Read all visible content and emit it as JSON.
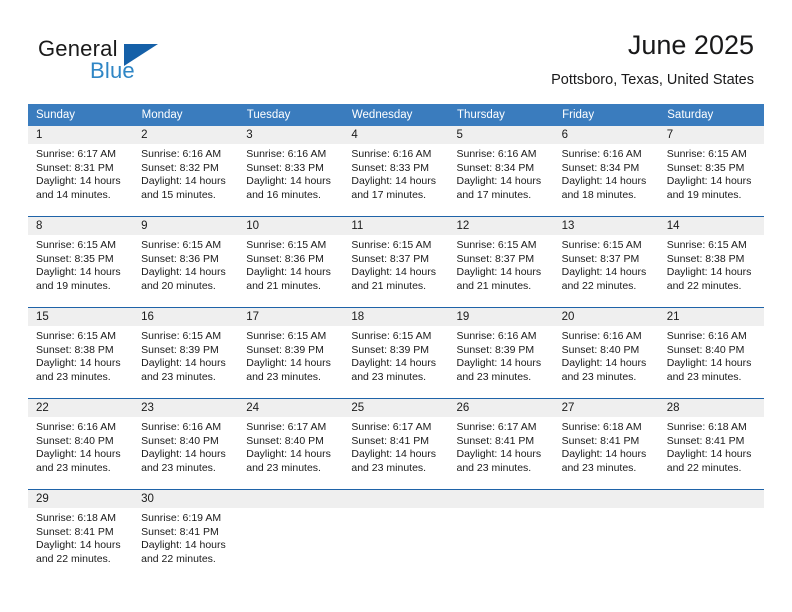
{
  "brand": {
    "line1": "General",
    "line2": "Blue",
    "flag_icon": "triangle-flag-icon",
    "accent_color": "#1560a8",
    "blue_text_color": "#2f86c5"
  },
  "header": {
    "month_title": "June 2025",
    "location": "Pottsboro, Texas, United States"
  },
  "theme": {
    "header_row_bg": "#3a7cbe",
    "daynum_band_bg": "#efefef",
    "row_separator": "#1f63a8",
    "text_color": "#1a1a1a"
  },
  "weekday_headers": [
    "Sunday",
    "Monday",
    "Tuesday",
    "Wednesday",
    "Thursday",
    "Friday",
    "Saturday"
  ],
  "weeks": [
    [
      {
        "day": "1",
        "sunrise": "Sunrise: 6:17 AM",
        "sunset": "Sunset: 8:31 PM",
        "daylight_line1": "Daylight: 14 hours",
        "daylight_line2": "and 14 minutes."
      },
      {
        "day": "2",
        "sunrise": "Sunrise: 6:16 AM",
        "sunset": "Sunset: 8:32 PM",
        "daylight_line1": "Daylight: 14 hours",
        "daylight_line2": "and 15 minutes."
      },
      {
        "day": "3",
        "sunrise": "Sunrise: 6:16 AM",
        "sunset": "Sunset: 8:33 PM",
        "daylight_line1": "Daylight: 14 hours",
        "daylight_line2": "and 16 minutes."
      },
      {
        "day": "4",
        "sunrise": "Sunrise: 6:16 AM",
        "sunset": "Sunset: 8:33 PM",
        "daylight_line1": "Daylight: 14 hours",
        "daylight_line2": "and 17 minutes."
      },
      {
        "day": "5",
        "sunrise": "Sunrise: 6:16 AM",
        "sunset": "Sunset: 8:34 PM",
        "daylight_line1": "Daylight: 14 hours",
        "daylight_line2": "and 17 minutes."
      },
      {
        "day": "6",
        "sunrise": "Sunrise: 6:16 AM",
        "sunset": "Sunset: 8:34 PM",
        "daylight_line1": "Daylight: 14 hours",
        "daylight_line2": "and 18 minutes."
      },
      {
        "day": "7",
        "sunrise": "Sunrise: 6:15 AM",
        "sunset": "Sunset: 8:35 PM",
        "daylight_line1": "Daylight: 14 hours",
        "daylight_line2": "and 19 minutes."
      }
    ],
    [
      {
        "day": "8",
        "sunrise": "Sunrise: 6:15 AM",
        "sunset": "Sunset: 8:35 PM",
        "daylight_line1": "Daylight: 14 hours",
        "daylight_line2": "and 19 minutes."
      },
      {
        "day": "9",
        "sunrise": "Sunrise: 6:15 AM",
        "sunset": "Sunset: 8:36 PM",
        "daylight_line1": "Daylight: 14 hours",
        "daylight_line2": "and 20 minutes."
      },
      {
        "day": "10",
        "sunrise": "Sunrise: 6:15 AM",
        "sunset": "Sunset: 8:36 PM",
        "daylight_line1": "Daylight: 14 hours",
        "daylight_line2": "and 21 minutes."
      },
      {
        "day": "11",
        "sunrise": "Sunrise: 6:15 AM",
        "sunset": "Sunset: 8:37 PM",
        "daylight_line1": "Daylight: 14 hours",
        "daylight_line2": "and 21 minutes."
      },
      {
        "day": "12",
        "sunrise": "Sunrise: 6:15 AM",
        "sunset": "Sunset: 8:37 PM",
        "daylight_line1": "Daylight: 14 hours",
        "daylight_line2": "and 21 minutes."
      },
      {
        "day": "13",
        "sunrise": "Sunrise: 6:15 AM",
        "sunset": "Sunset: 8:37 PM",
        "daylight_line1": "Daylight: 14 hours",
        "daylight_line2": "and 22 minutes."
      },
      {
        "day": "14",
        "sunrise": "Sunrise: 6:15 AM",
        "sunset": "Sunset: 8:38 PM",
        "daylight_line1": "Daylight: 14 hours",
        "daylight_line2": "and 22 minutes."
      }
    ],
    [
      {
        "day": "15",
        "sunrise": "Sunrise: 6:15 AM",
        "sunset": "Sunset: 8:38 PM",
        "daylight_line1": "Daylight: 14 hours",
        "daylight_line2": "and 23 minutes."
      },
      {
        "day": "16",
        "sunrise": "Sunrise: 6:15 AM",
        "sunset": "Sunset: 8:39 PM",
        "daylight_line1": "Daylight: 14 hours",
        "daylight_line2": "and 23 minutes."
      },
      {
        "day": "17",
        "sunrise": "Sunrise: 6:15 AM",
        "sunset": "Sunset: 8:39 PM",
        "daylight_line1": "Daylight: 14 hours",
        "daylight_line2": "and 23 minutes."
      },
      {
        "day": "18",
        "sunrise": "Sunrise: 6:15 AM",
        "sunset": "Sunset: 8:39 PM",
        "daylight_line1": "Daylight: 14 hours",
        "daylight_line2": "and 23 minutes."
      },
      {
        "day": "19",
        "sunrise": "Sunrise: 6:16 AM",
        "sunset": "Sunset: 8:39 PM",
        "daylight_line1": "Daylight: 14 hours",
        "daylight_line2": "and 23 minutes."
      },
      {
        "day": "20",
        "sunrise": "Sunrise: 6:16 AM",
        "sunset": "Sunset: 8:40 PM",
        "daylight_line1": "Daylight: 14 hours",
        "daylight_line2": "and 23 minutes."
      },
      {
        "day": "21",
        "sunrise": "Sunrise: 6:16 AM",
        "sunset": "Sunset: 8:40 PM",
        "daylight_line1": "Daylight: 14 hours",
        "daylight_line2": "and 23 minutes."
      }
    ],
    [
      {
        "day": "22",
        "sunrise": "Sunrise: 6:16 AM",
        "sunset": "Sunset: 8:40 PM",
        "daylight_line1": "Daylight: 14 hours",
        "daylight_line2": "and 23 minutes."
      },
      {
        "day": "23",
        "sunrise": "Sunrise: 6:16 AM",
        "sunset": "Sunset: 8:40 PM",
        "daylight_line1": "Daylight: 14 hours",
        "daylight_line2": "and 23 minutes."
      },
      {
        "day": "24",
        "sunrise": "Sunrise: 6:17 AM",
        "sunset": "Sunset: 8:40 PM",
        "daylight_line1": "Daylight: 14 hours",
        "daylight_line2": "and 23 minutes."
      },
      {
        "day": "25",
        "sunrise": "Sunrise: 6:17 AM",
        "sunset": "Sunset: 8:41 PM",
        "daylight_line1": "Daylight: 14 hours",
        "daylight_line2": "and 23 minutes."
      },
      {
        "day": "26",
        "sunrise": "Sunrise: 6:17 AM",
        "sunset": "Sunset: 8:41 PM",
        "daylight_line1": "Daylight: 14 hours",
        "daylight_line2": "and 23 minutes."
      },
      {
        "day": "27",
        "sunrise": "Sunrise: 6:18 AM",
        "sunset": "Sunset: 8:41 PM",
        "daylight_line1": "Daylight: 14 hours",
        "daylight_line2": "and 23 minutes."
      },
      {
        "day": "28",
        "sunrise": "Sunrise: 6:18 AM",
        "sunset": "Sunset: 8:41 PM",
        "daylight_line1": "Daylight: 14 hours",
        "daylight_line2": "and 22 minutes."
      }
    ],
    [
      {
        "day": "29",
        "sunrise": "Sunrise: 6:18 AM",
        "sunset": "Sunset: 8:41 PM",
        "daylight_line1": "Daylight: 14 hours",
        "daylight_line2": "and 22 minutes."
      },
      {
        "day": "30",
        "sunrise": "Sunrise: 6:19 AM",
        "sunset": "Sunset: 8:41 PM",
        "daylight_line1": "Daylight: 14 hours",
        "daylight_line2": "and 22 minutes."
      },
      {
        "day": "",
        "sunrise": "",
        "sunset": "",
        "daylight_line1": "",
        "daylight_line2": ""
      },
      {
        "day": "",
        "sunrise": "",
        "sunset": "",
        "daylight_line1": "",
        "daylight_line2": ""
      },
      {
        "day": "",
        "sunrise": "",
        "sunset": "",
        "daylight_line1": "",
        "daylight_line2": ""
      },
      {
        "day": "",
        "sunrise": "",
        "sunset": "",
        "daylight_line1": "",
        "daylight_line2": ""
      },
      {
        "day": "",
        "sunrise": "",
        "sunset": "",
        "daylight_line1": "",
        "daylight_line2": ""
      }
    ]
  ]
}
